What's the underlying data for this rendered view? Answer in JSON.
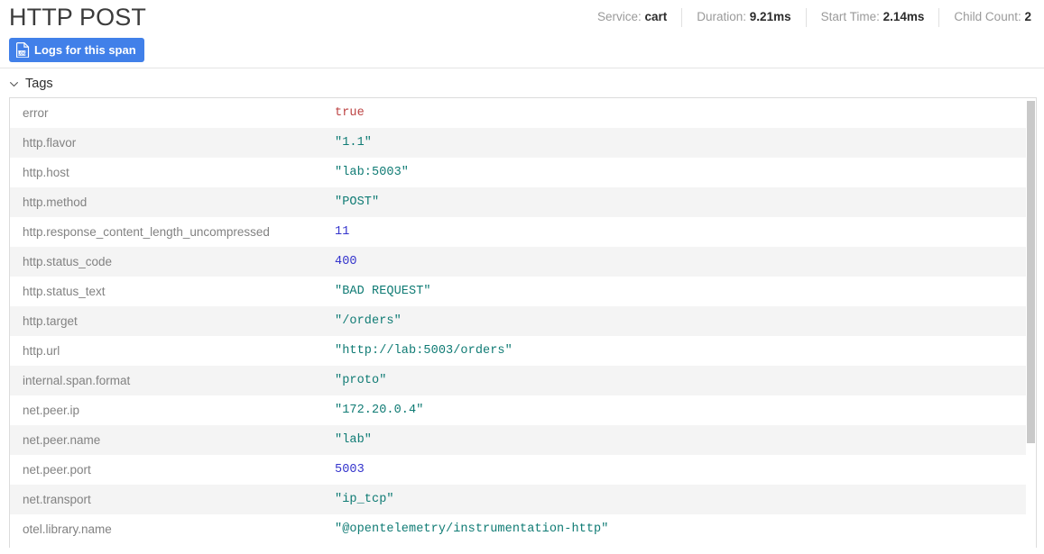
{
  "header": {
    "title": "HTTP POST",
    "logs_button": {
      "label": "Logs for this span",
      "icon": "log-document-icon"
    },
    "meta": [
      {
        "label": "Service:",
        "value": "cart"
      },
      {
        "label": "Duration:",
        "value": "9.21ms"
      },
      {
        "label": "Start Time:",
        "value": "2.14ms"
      },
      {
        "label": "Child Count:",
        "value": "2"
      }
    ]
  },
  "tags_section": {
    "title": "Tags",
    "expanded": true,
    "chevron_icon": "chevron-down-icon",
    "rows": [
      {
        "key": "error",
        "value": "true",
        "type": "bool"
      },
      {
        "key": "http.flavor",
        "value": "\"1.1\"",
        "type": "string"
      },
      {
        "key": "http.host",
        "value": "\"lab:5003\"",
        "type": "string"
      },
      {
        "key": "http.method",
        "value": "\"POST\"",
        "type": "string"
      },
      {
        "key": "http.response_content_length_uncompressed",
        "value": "11",
        "type": "number"
      },
      {
        "key": "http.status_code",
        "value": "400",
        "type": "number"
      },
      {
        "key": "http.status_text",
        "value": "\"BAD REQUEST\"",
        "type": "string"
      },
      {
        "key": "http.target",
        "value": "\"/orders\"",
        "type": "string"
      },
      {
        "key": "http.url",
        "value": "\"http://lab:5003/orders\"",
        "type": "string"
      },
      {
        "key": "internal.span.format",
        "value": "\"proto\"",
        "type": "string"
      },
      {
        "key": "net.peer.ip",
        "value": "\"172.20.0.4\"",
        "type": "string"
      },
      {
        "key": "net.peer.name",
        "value": "\"lab\"",
        "type": "string"
      },
      {
        "key": "net.peer.port",
        "value": "5003",
        "type": "number"
      },
      {
        "key": "net.transport",
        "value": "\"ip_tcp\"",
        "type": "string"
      },
      {
        "key": "otel.library.name",
        "value": "\"@opentelemetry/instrumentation-http\"",
        "type": "string"
      }
    ]
  },
  "colors": {
    "accent_button": "#4180e9",
    "string_value": "#0f7b74",
    "number_value": "#3434cc",
    "bool_value": "#bc4242",
    "key_text": "#828282",
    "row_stripe": "#f4f4f4"
  }
}
